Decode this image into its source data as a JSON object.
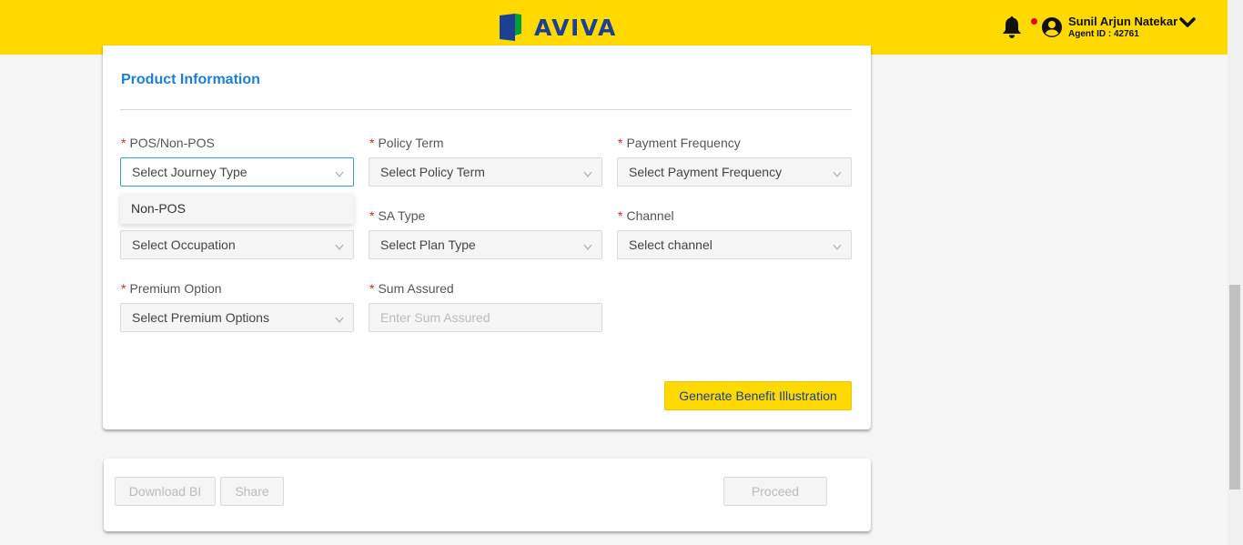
{
  "header": {
    "brand": "AVIVA",
    "user_name": "Sunil Arjun Natekar",
    "agent_id": "Agent ID : 42761",
    "brand_color": "#1d3f94",
    "accent_color": "#ffd900"
  },
  "section": {
    "title": "Product Information"
  },
  "fields": {
    "pos": {
      "label": "POS/Non-POS",
      "value": "Select Journey Type"
    },
    "policy_term": {
      "label": "Policy Term",
      "value": "Select Policy Term"
    },
    "payment_frequency": {
      "label": "Payment Frequency",
      "value": "Select Payment Frequency"
    },
    "occupation": {
      "value": "Select Occupation"
    },
    "sa_type": {
      "label": "SA Type",
      "value": "Select Plan Type"
    },
    "channel": {
      "label": "Channel",
      "value": "Select channel"
    },
    "premium_option": {
      "label": "Premium Option",
      "value": "Select Premium Options"
    },
    "sum_assured": {
      "label": "Sum Assured",
      "placeholder": "Enter Sum Assured"
    }
  },
  "dropdown": {
    "options": [
      "Non-POS"
    ]
  },
  "actions": {
    "generate": "Generate Benefit Illustration",
    "download": "Download BI",
    "share": "Share",
    "proceed": "Proceed"
  },
  "required_marker": "*"
}
